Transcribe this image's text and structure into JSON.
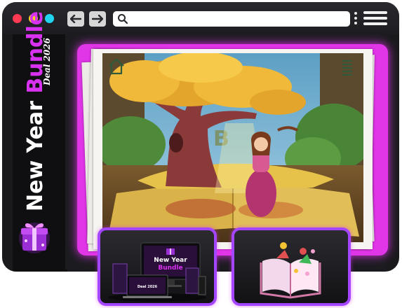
{
  "window": {
    "controls": [
      "close",
      "minimize",
      "zoom"
    ],
    "nav": {
      "back_icon": "arrow-left-icon",
      "forward_icon": "arrow-right-icon"
    },
    "address_bar": {
      "icon": "search-icon",
      "value": ""
    },
    "menu_icons": [
      "kebab-icon",
      "hamburger-menu-icon"
    ]
  },
  "sidebar": {
    "title_line1": "New Year ",
    "title_line2": "Bundle",
    "subtitle": "Deal 2026",
    "logo_icon": "gift-box-icon",
    "colors": {
      "accent": "#d832f0",
      "text": "#ffffff"
    }
  },
  "main": {
    "scene": {
      "home_icon": "home-icon",
      "menu_icon": "menu-lines-icon",
      "tree_letter": "B"
    }
  },
  "cards": [
    {
      "name": "bundle-product-mockup",
      "mockup_title_1": "New Year",
      "mockup_title_2": "Bundle",
      "mockup_subtitle": "Deal 2026"
    },
    {
      "name": "popup-book-card",
      "icon": "open-book-icon"
    }
  ],
  "colors": {
    "frame": "#1a1a1d",
    "glow": "#e135e8",
    "card_border": "#a445ff",
    "dot_red": "#ff3a52",
    "dot_yellow": "#ffd21f",
    "dot_cyan": "#21d4f0"
  }
}
